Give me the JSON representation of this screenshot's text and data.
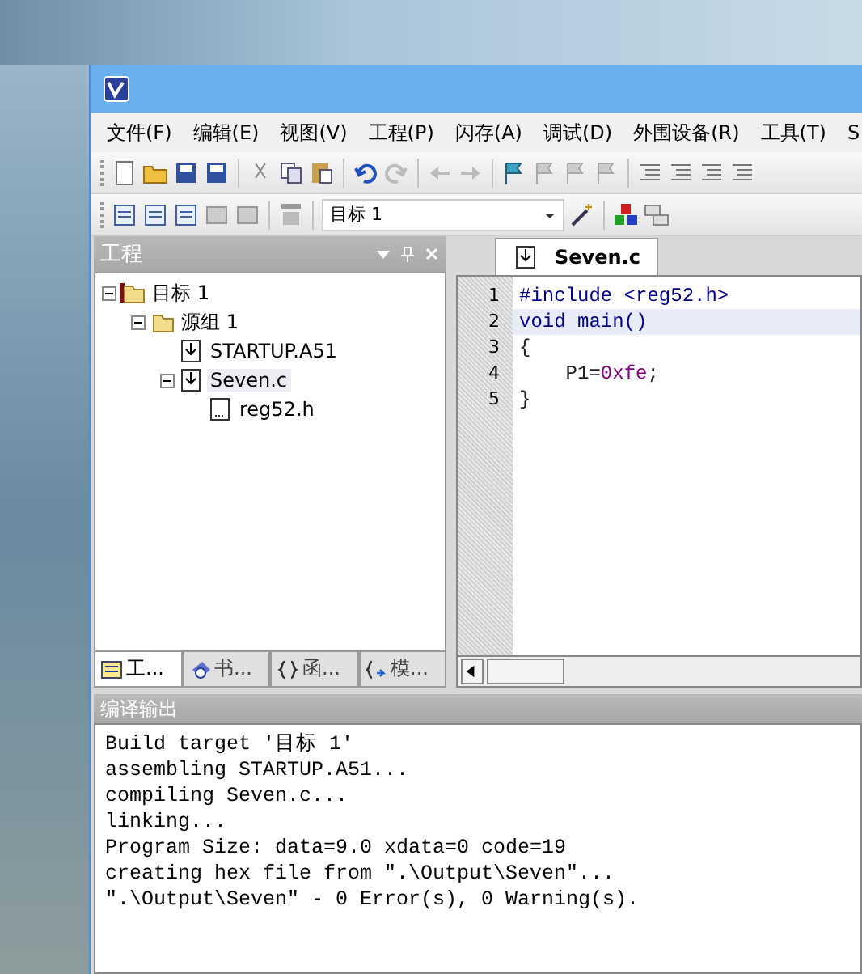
{
  "menu": [
    "文件(F)",
    "编辑(E)",
    "视图(V)",
    "工程(P)",
    "闪存(A)",
    "调试(D)",
    "外围设备(R)",
    "工具(T)",
    "S"
  ],
  "target_select": {
    "value": "目标 1"
  },
  "project_panel": {
    "title": "工程",
    "tree": [
      {
        "label": "目标 1",
        "kind": "target",
        "expanded": true,
        "selected": false,
        "children": [
          {
            "label": "源组 1",
            "kind": "group",
            "expanded": true,
            "selected": false,
            "children": [
              {
                "label": "STARTUP.A51",
                "kind": "source",
                "selected": false
              },
              {
                "label": "Seven.c",
                "kind": "source",
                "expanded": true,
                "selected": true,
                "children": [
                  {
                    "label": "reg52.h",
                    "kind": "header",
                    "selected": false
                  }
                ]
              }
            ]
          }
        ]
      }
    ],
    "tabs": [
      {
        "label": "工...",
        "kind": "project",
        "selected": true
      },
      {
        "label": "书...",
        "kind": "books",
        "selected": false
      },
      {
        "label": "函...",
        "kind": "functions",
        "selected": false
      },
      {
        "label": "模...",
        "kind": "templates",
        "selected": false
      }
    ]
  },
  "editor": {
    "tab": "Seven.c",
    "lines": [
      {
        "number": "1",
        "current": false,
        "tokens": [
          {
            "text": "#include <reg52.h>",
            "kind": "keyword"
          }
        ]
      },
      {
        "number": "2",
        "current": true,
        "tokens": [
          {
            "text": "void main()",
            "kind": "keyword"
          }
        ]
      },
      {
        "number": "3",
        "current": false,
        "tokens": [
          {
            "text": "{",
            "kind": "plain"
          }
        ]
      },
      {
        "number": "4",
        "current": false,
        "tokens": [
          {
            "text": "    P1=",
            "kind": "plain"
          },
          {
            "text": "0xfe",
            "kind": "number"
          },
          {
            "text": ";",
            "kind": "plain"
          }
        ]
      },
      {
        "number": "5",
        "current": false,
        "tokens": [
          {
            "text": "}",
            "kind": "plain"
          }
        ]
      }
    ]
  },
  "output": {
    "title": "编译输出",
    "lines": [
      "Build target '目标 1'",
      "assembling STARTUP.A51...",
      "compiling Seven.c...",
      "linking...",
      "Program Size: data=9.0 xdata=0 code=19",
      "creating hex file from \".\\Output\\Seven\"...",
      "\".\\Output\\Seven\" - 0 Error(s), 0 Warning(s)."
    ]
  }
}
